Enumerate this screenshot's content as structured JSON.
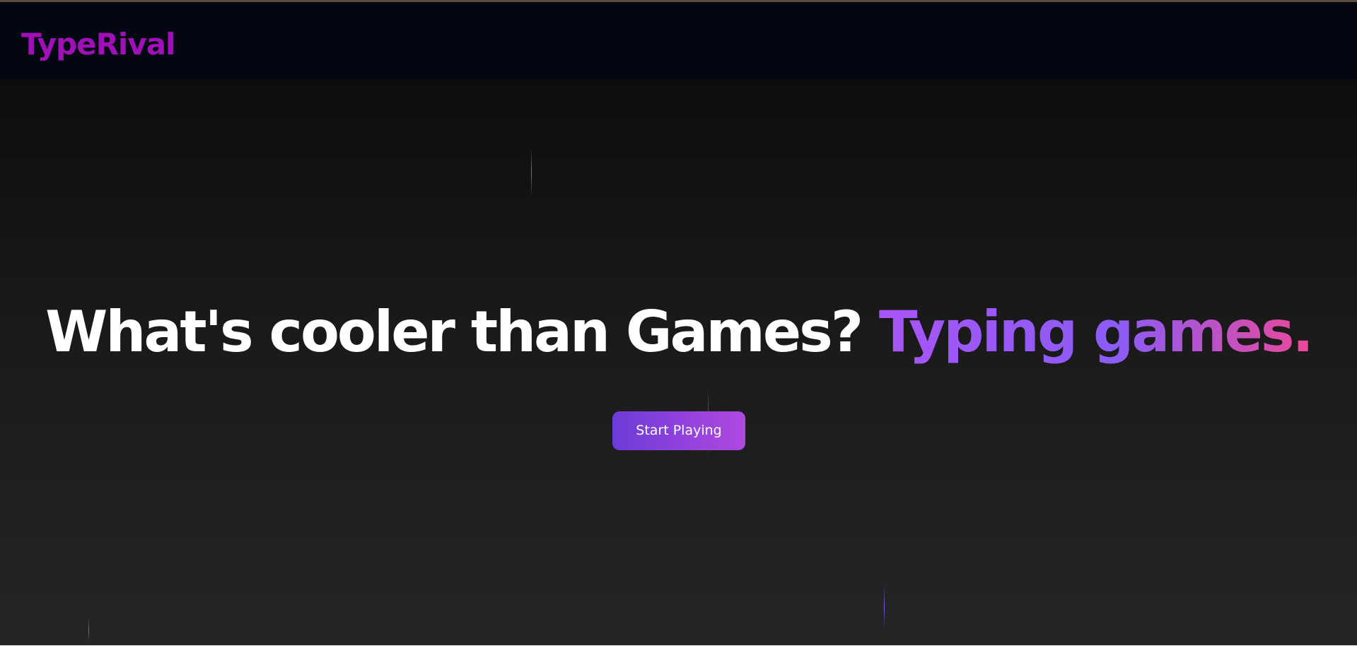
{
  "navbar": {
    "brand": "TypeRival"
  },
  "hero": {
    "headline_plain": "What's cooler than Games? ",
    "headline_accent": "Typing games.",
    "cta_label": "Start Playing"
  },
  "colors": {
    "navbar_bg": "#030712",
    "brand": "#a10fb8",
    "accent_start": "#a855f7",
    "accent_end": "#ec4899",
    "button_start": "#6d3bd8",
    "button_end": "#b048e0"
  }
}
